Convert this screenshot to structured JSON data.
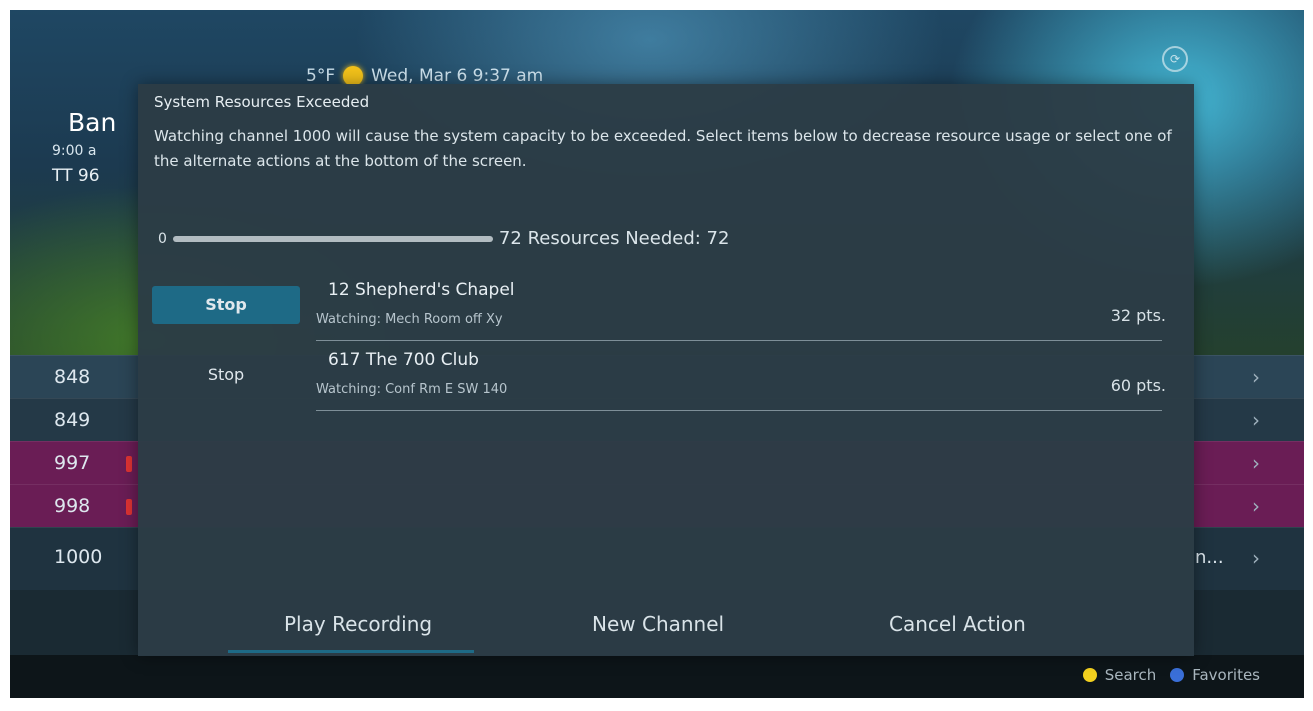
{
  "header": {
    "temperature": "5°F",
    "datetime": "Wed, Mar 6 9:37 am"
  },
  "program": {
    "title": "Ban",
    "time": "9:00 a",
    "code": "TT 96"
  },
  "channels": [
    {
      "number": "848"
    },
    {
      "number": "849"
    },
    {
      "number": "997"
    },
    {
      "number": "998"
    },
    {
      "number": "1000",
      "trail": "n..."
    }
  ],
  "bottom_bar": {
    "search_label": "Search",
    "favorites_label": "Favorites",
    "search_color": "#f3d11f",
    "favorites_color": "#3a6fd8"
  },
  "dialog": {
    "title": "System Resources Exceeded",
    "message": "Watching channel 1000 will cause the system capacity to be exceeded. Select items below to decrease resource usage or select one of the alternate actions at the bottom of the screen.",
    "resource_min": "0",
    "resource_max": "72",
    "resource_text": "Resources Needed: 72",
    "resource_fill_fraction": 1.0,
    "items": [
      {
        "button": "Stop",
        "title": "12 Shepherd's Chapel",
        "subtitle": "Watching: Mech Room off Xy",
        "points": "32 pts.",
        "selected": true
      },
      {
        "button": "Stop",
        "title": "617 The 700 Club",
        "subtitle": "Watching: Conf Rm E SW 140",
        "points": "60 pts.",
        "selected": false
      }
    ],
    "actions": {
      "play_recording": "Play Recording",
      "new_channel": "New Channel",
      "cancel_action": "Cancel Action"
    }
  }
}
